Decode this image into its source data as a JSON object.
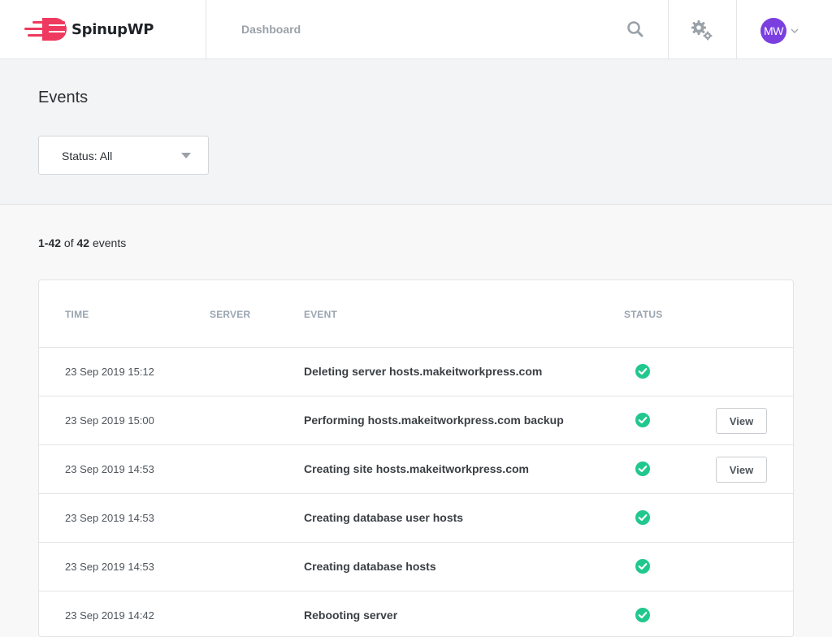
{
  "app": {
    "brand": "SpinupWP",
    "brand_color": "#ee3a5e",
    "accent_color": "#7b3fe0",
    "success_color": "#21c88e"
  },
  "nav": {
    "dashboard_label": "Dashboard",
    "search_icon": "search-icon",
    "settings_icon": "gear-icon",
    "user_initials": "MW"
  },
  "page": {
    "title": "Events",
    "status_filter": "Status: All"
  },
  "count": {
    "range": "1-42",
    "of_label": "of",
    "total": "42",
    "unit": "events"
  },
  "table": {
    "headers": {
      "time": "TIME",
      "server": "SERVER",
      "event": "EVENT",
      "status": "STATUS"
    },
    "rows": [
      {
        "time": "23 Sep 2019 15:12",
        "server": "",
        "event": "Deleting server hosts.makeitworkpress.com",
        "status": "success",
        "view": ""
      },
      {
        "time": "23 Sep 2019 15:00",
        "server": "",
        "event": "Performing hosts.makeitworkpress.com backup",
        "status": "success",
        "view": "View"
      },
      {
        "time": "23 Sep 2019 14:53",
        "server": "",
        "event": "Creating site hosts.makeitworkpress.com",
        "status": "success",
        "view": "View"
      },
      {
        "time": "23 Sep 2019 14:53",
        "server": "",
        "event": "Creating database user hosts",
        "status": "success",
        "view": ""
      },
      {
        "time": "23 Sep 2019 14:53",
        "server": "",
        "event": "Creating database hosts",
        "status": "success",
        "view": ""
      },
      {
        "time": "23 Sep 2019 14:42",
        "server": "",
        "event": "Rebooting server",
        "status": "success",
        "view": ""
      }
    ]
  }
}
